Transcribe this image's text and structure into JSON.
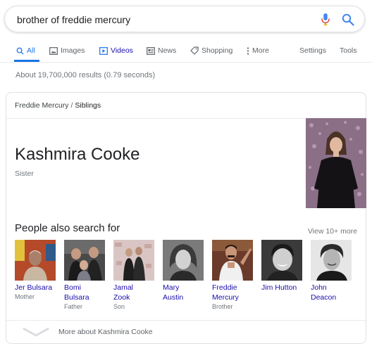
{
  "search": {
    "query": "brother of freddie mercury"
  },
  "tabs": [
    {
      "label": "All",
      "icon": "search-icon"
    },
    {
      "label": "Images",
      "icon": "image-icon"
    },
    {
      "label": "Videos",
      "icon": "video-icon"
    },
    {
      "label": "News",
      "icon": "news-icon"
    },
    {
      "label": "Shopping",
      "icon": "tag-icon"
    },
    {
      "label": "More",
      "icon": "more-vert-icon"
    }
  ],
  "tools": {
    "settings": "Settings",
    "tools": "Tools"
  },
  "results_count": "About 19,700,000 results (0.79 seconds)",
  "knowledge_panel": {
    "breadcrumb": {
      "parent": "Freddie Mercury",
      "separator": "/",
      "current": "Siblings"
    },
    "entity_name": "Kashmira Cooke",
    "entity_type": "Sister",
    "people_also_search_title": "People also search for",
    "view_more": "View 10+ more",
    "people": [
      {
        "name_line1": "Jer Bulsara",
        "name_line2": "",
        "relation": "Mother"
      },
      {
        "name_line1": "Bomi",
        "name_line2": "Bulsara",
        "relation": "Father"
      },
      {
        "name_line1": "Jamal",
        "name_line2": "Zook",
        "relation": "Son"
      },
      {
        "name_line1": "Mary",
        "name_line2": "Austin",
        "relation": ""
      },
      {
        "name_line1": "Freddie",
        "name_line2": "Mercury",
        "relation": "Brother"
      },
      {
        "name_line1": "Jim Hutton",
        "name_line2": "",
        "relation": ""
      },
      {
        "name_line1": "John",
        "name_line2": "Deacon",
        "relation": ""
      }
    ],
    "more_about": "More about Kashmira Cooke"
  },
  "colors": {
    "accent": "#1a73e8",
    "link": "#1a0dab",
    "muted": "#70757a",
    "border": "#dfe1e5"
  }
}
